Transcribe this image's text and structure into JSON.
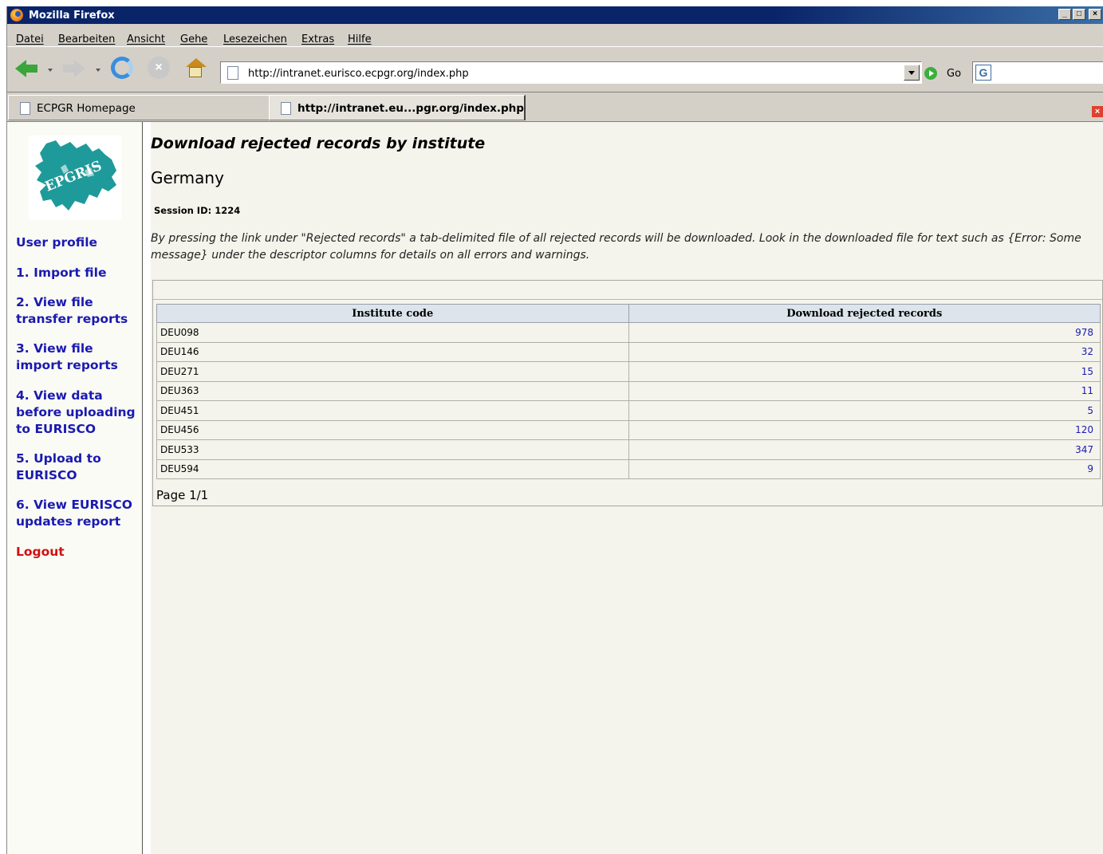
{
  "window": {
    "title": "Mozilla Firefox",
    "buttons": {
      "minimize": "_",
      "maximize": "□",
      "close": "×"
    }
  },
  "menu": [
    "Datei",
    "Bearbeiten",
    "Ansicht",
    "Gehe",
    "Lesezeichen",
    "Extras",
    "Hilfe"
  ],
  "toolbar": {
    "url": "http://intranet.eurisco.ecpgr.org/index.php",
    "go_label": "Go",
    "search_icon_letter": "G"
  },
  "tabs": [
    {
      "label": "ECPGR Homepage",
      "active": false
    },
    {
      "label": "http://intranet.eu...pgr.org/index.php",
      "active": true
    }
  ],
  "sidebar": {
    "logo_text": "EPGRIS",
    "links": [
      {
        "label": "User profile"
      },
      {
        "label": "1. Import file"
      },
      {
        "label": "2. View file transfer reports"
      },
      {
        "label": "3. View file import reports"
      },
      {
        "label": "4. View data before uploading to EURISCO"
      },
      {
        "label": "5. Upload to EURISCO"
      },
      {
        "label": "6. View EURISCO updates report"
      },
      {
        "label": "Logout"
      }
    ]
  },
  "main": {
    "title": "Download rejected records by institute",
    "country": "Germany",
    "session": "Session ID: 1224",
    "description": "By pressing the link under \"Rejected records\" a tab-delimited file of all rejected records will be downloaded. Look in the downloaded file for text such as {Error: Some message} under the descriptor columns for details on all errors and warnings.",
    "table": {
      "headers": [
        "Institute code",
        "Download rejected records"
      ],
      "rows": [
        {
          "code": "DEU098",
          "count": "978"
        },
        {
          "code": "DEU146",
          "count": "32"
        },
        {
          "code": "DEU271",
          "count": "15"
        },
        {
          "code": "DEU363",
          "count": "11"
        },
        {
          "code": "DEU451",
          "count": "5"
        },
        {
          "code": "DEU456",
          "count": "120"
        },
        {
          "code": "DEU533",
          "count": "347"
        },
        {
          "code": "DEU594",
          "count": "9"
        }
      ]
    },
    "pager": "Page 1/1"
  },
  "colors": {
    "titlebar": "#0a246a",
    "chrome": "#d4d0c8",
    "link": "#1a1ab0",
    "logout": "#d01010",
    "logo_teal": "#1f9a9a"
  }
}
